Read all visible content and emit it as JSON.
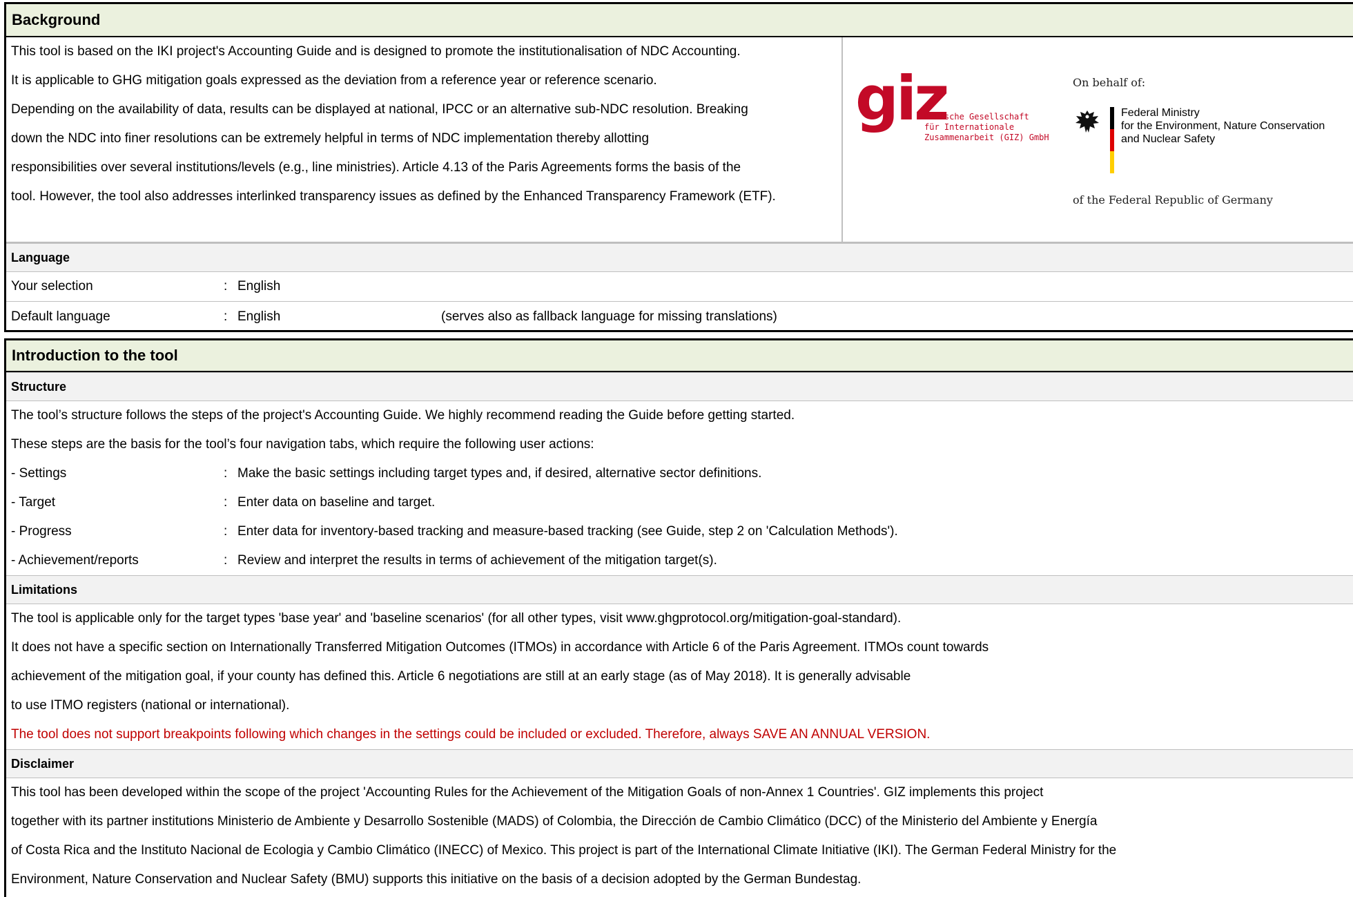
{
  "background": {
    "title": "Background",
    "lines": [
      "This tool is based on the IKI project's Accounting Guide and is designed to promote the institutionalisation of NDC Accounting.",
      "It is applicable to GHG mitigation goals expressed as the deviation from a reference year or reference scenario.",
      "Depending on the availability of data, results can be displayed at national, IPCC or an alternative sub-NDC resolution. Breaking",
      "down the NDC into finer resolutions can be extremely helpful in terms of NDC implementation thereby allotting",
      "responsibilities over several institutions/levels (e.g., line ministries). Article 4.13 of the Paris Agreements forms the basis of the",
      "tool. However, the tool also addresses interlinked transparency issues as defined by the Enhanced Transparency Framework (ETF)."
    ],
    "logos": {
      "giz_mark": "giz",
      "giz_sub": [
        "Deutsche Gesellschaft",
        "für Internationale",
        "Zusammenarbeit (GIZ) GmbH"
      ],
      "on_behalf": "On behalf of:",
      "eagle_icon": "federal-eagle-icon",
      "ministry": [
        "Federal Ministry",
        "for the Environment, Nature Conservation",
        "and Nuclear Safety"
      ],
      "republic": "of the Federal Republic of Germany",
      "flag_colors": [
        "#000000",
        "#dd0000",
        "#ffce00"
      ]
    }
  },
  "language": {
    "title": "Language",
    "colon": ":",
    "selection_label": "Your selection",
    "selection_value": "English",
    "default_label": "Default language",
    "default_value": "English",
    "default_note": "(serves also as fallback language for missing translations)"
  },
  "intro": {
    "title": "Introduction to the tool",
    "structure": {
      "title": "Structure",
      "lines": [
        "The tool’s structure follows the steps of the project's Accounting Guide. We highly recommend reading the Guide before getting started.",
        "These steps are the basis for the tool’s four navigation tabs, which require the following user actions:"
      ],
      "steps": [
        {
          "label": "- Settings",
          "desc": "Make the basic settings including target types and, if desired, alternative sector definitions."
        },
        {
          "label": "- Target",
          "desc": "Enter data on baseline and target."
        },
        {
          "label": "- Progress",
          "desc": "Enter data for inventory-based tracking and measure-based tracking (see Guide, step 2 on 'Calculation Methods')."
        },
        {
          "label": "- Achievement/reports",
          "desc": "Review and interpret the results in terms of achievement of the mitigation target(s)."
        }
      ]
    },
    "limitations": {
      "title": "Limitations",
      "lines": [
        "The tool is applicable only for the target types 'base year' and 'baseline scenarios' (for all other types, visit www.ghgprotocol.org/mitigation-goal-standard).",
        "It does not have a specific section on Internationally Transferred Mitigation Outcomes (ITMOs) in accordance with Article 6 of the Paris Agreement. ITMOs count towards",
        "achievement of the mitigation goal, if your county has defined this. Article 6 negotiations are still at an early stage (as of May 2018). It is generally advisable",
        "to use ITMO registers (national or international)."
      ],
      "warning": "The tool does not support breakpoints following which changes in the settings could be included or excluded. Therefore, always SAVE AN ANNUAL VERSION."
    },
    "disclaimer": {
      "title": "Disclaimer",
      "lines": [
        "This tool has been developed within the scope of the project 'Accounting Rules for the Achievement of the Mitigation Goals of non-Annex 1 Countries'. GIZ implements this project",
        "together with its partner institutions Ministerio de Ambiente y Desarrollo Sostenible (MADS) of Colombia, the Dirección de Cambio Climático (DCC) of the Ministerio del Ambiente y Energía",
        "of Costa Rica and the Instituto Nacional de Ecologia y Cambio Climático (INECC) of Mexico. This project is part of the International Climate Initiative (IKI). The German Federal Ministry for the",
        "Environment, Nature Conservation and Nuclear Safety (BMU) supports this initiative on the basis of a decision adopted by the German Bundestag."
      ]
    }
  },
  "colors": {
    "header_bg": "#ebf1de",
    "subheader_bg": "#f2f2f2",
    "warning_text": "#c00000",
    "giz_red": "#c30a27"
  }
}
